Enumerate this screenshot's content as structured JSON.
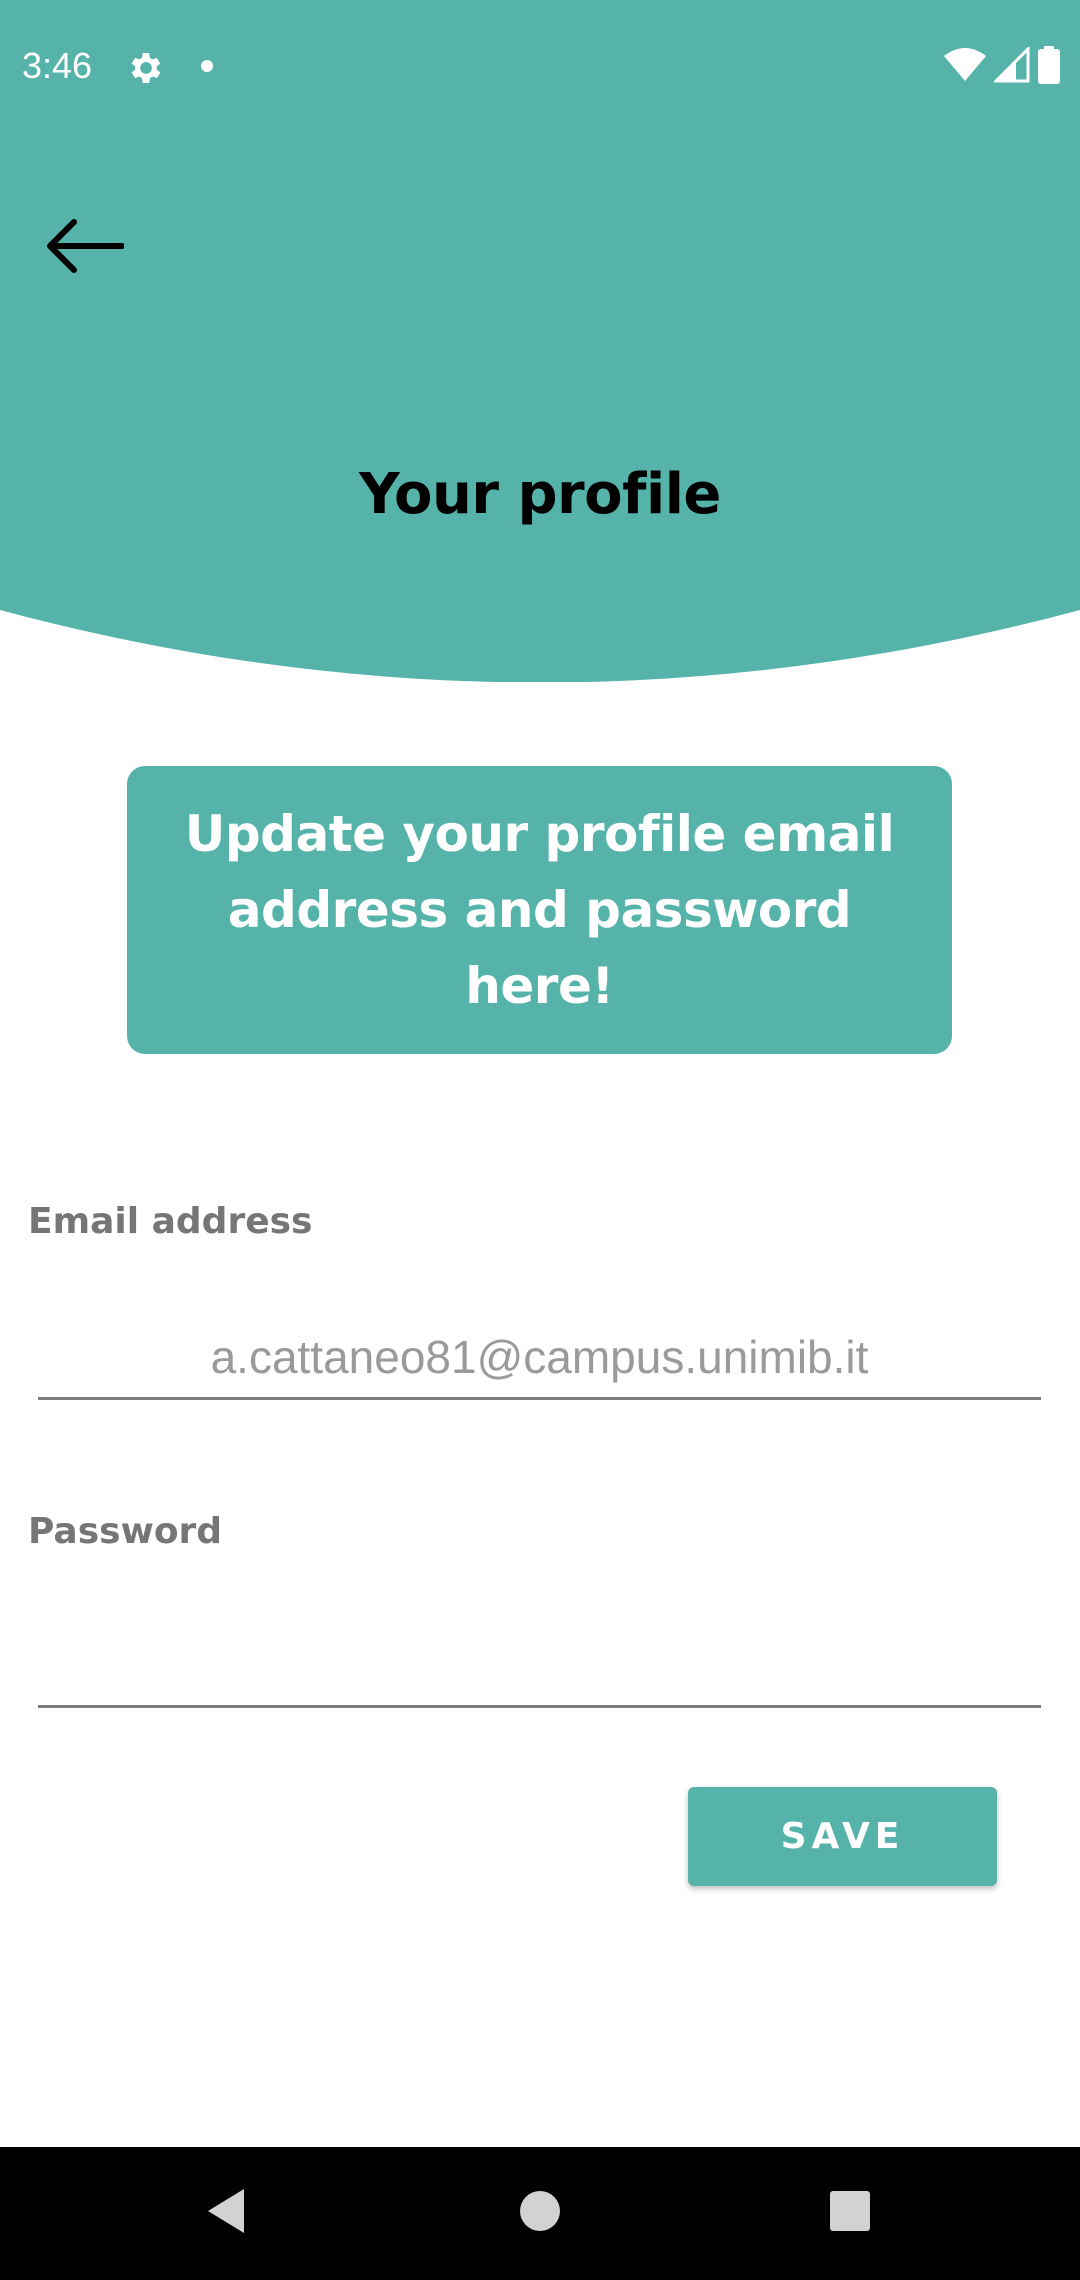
{
  "colors": {
    "accent": "#55b3aa",
    "title_text": "#000000",
    "label_text": "#767676",
    "input_text": "#9a9a9a",
    "nav_bar": "#000000"
  },
  "status_bar": {
    "time": "3:46",
    "icons": [
      "gear-icon",
      "notification-dot-icon",
      "wifi-icon",
      "cell-signal-icon",
      "battery-icon"
    ]
  },
  "header": {
    "back_icon": "arrow-left-icon",
    "title": "Your profile"
  },
  "info_card": {
    "text": "Update your profile email address and password here!"
  },
  "form": {
    "email": {
      "label": "Email address",
      "value": "a.cattaneo81@campus.unimib.it"
    },
    "password": {
      "label": "Password",
      "value": ""
    },
    "save_label": "SAVE"
  },
  "nav_bar": {
    "icons": [
      "nav-back-icon",
      "nav-home-icon",
      "nav-recents-icon"
    ]
  }
}
